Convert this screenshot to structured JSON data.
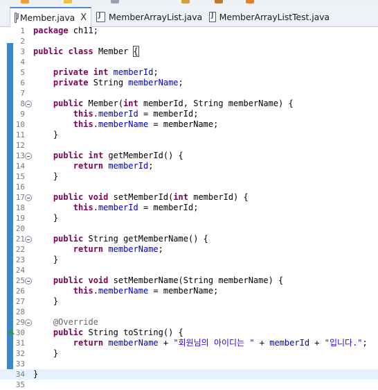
{
  "tabs": [
    {
      "label": "Member.java",
      "active": true,
      "close": "X"
    },
    {
      "label": "MemberArrayList.java",
      "active": false
    },
    {
      "label": "MemberArrayListTest.java",
      "active": false
    }
  ],
  "colors": {
    "keyword": "#7f0055",
    "field": "#0000c0",
    "string": "#2a00ff",
    "annotation": "#646464",
    "line_number": "#787878",
    "current_line": "#e8f2fe",
    "change_bar": "#3f86c8"
  },
  "editor": {
    "current_line": 34,
    "lines": [
      {
        "n": "1",
        "tokens": [
          [
            "kw",
            "package"
          ],
          [
            "t",
            " ch11;"
          ]
        ]
      },
      {
        "n": "2",
        "tokens": []
      },
      {
        "n": "3",
        "tokens": [
          [
            "kw",
            "public"
          ],
          [
            "t",
            " "
          ],
          [
            "kw",
            "class"
          ],
          [
            "t",
            " Member "
          ],
          [
            "brace",
            "{"
          ]
        ]
      },
      {
        "n": "4",
        "tokens": []
      },
      {
        "n": "5",
        "tokens": [
          [
            "t",
            "    "
          ],
          [
            "kw",
            "private"
          ],
          [
            "t",
            " "
          ],
          [
            "kw",
            "int"
          ],
          [
            "t",
            " "
          ],
          [
            "fld",
            "memberId"
          ],
          [
            "t",
            ";"
          ]
        ]
      },
      {
        "n": "6",
        "tokens": [
          [
            "t",
            "    "
          ],
          [
            "kw",
            "private"
          ],
          [
            "t",
            " String "
          ],
          [
            "fld",
            "memberName"
          ],
          [
            "t",
            ";"
          ]
        ]
      },
      {
        "n": "7",
        "tokens": []
      },
      {
        "n": "8",
        "fold": true,
        "tokens": [
          [
            "t",
            "    "
          ],
          [
            "kw",
            "public"
          ],
          [
            "t",
            " Member("
          ],
          [
            "kw",
            "int"
          ],
          [
            "t",
            " memberId, String memberName) {"
          ]
        ]
      },
      {
        "n": "9",
        "tokens": [
          [
            "t",
            "        "
          ],
          [
            "kw",
            "this"
          ],
          [
            "t",
            "."
          ],
          [
            "fld",
            "memberId"
          ],
          [
            "t",
            " = memberId;"
          ]
        ]
      },
      {
        "n": "10",
        "tokens": [
          [
            "t",
            "        "
          ],
          [
            "kw",
            "this"
          ],
          [
            "t",
            "."
          ],
          [
            "fld",
            "memberName"
          ],
          [
            "t",
            " = memberName;"
          ]
        ]
      },
      {
        "n": "11",
        "tokens": [
          [
            "t",
            "    }"
          ]
        ]
      },
      {
        "n": "12",
        "tokens": []
      },
      {
        "n": "13",
        "fold": true,
        "tokens": [
          [
            "t",
            "    "
          ],
          [
            "kw",
            "public"
          ],
          [
            "t",
            " "
          ],
          [
            "kw",
            "int"
          ],
          [
            "t",
            " getMemberId() {"
          ]
        ]
      },
      {
        "n": "14",
        "tokens": [
          [
            "t",
            "        "
          ],
          [
            "kw",
            "return"
          ],
          [
            "t",
            " "
          ],
          [
            "fld",
            "memberId"
          ],
          [
            "t",
            ";"
          ]
        ]
      },
      {
        "n": "15",
        "tokens": [
          [
            "t",
            "    }"
          ]
        ]
      },
      {
        "n": "16",
        "tokens": []
      },
      {
        "n": "17",
        "fold": true,
        "tokens": [
          [
            "t",
            "    "
          ],
          [
            "kw",
            "public"
          ],
          [
            "t",
            " "
          ],
          [
            "kw",
            "void"
          ],
          [
            "t",
            " setMemberId("
          ],
          [
            "kw",
            "int"
          ],
          [
            "t",
            " memberId) {"
          ]
        ]
      },
      {
        "n": "18",
        "tokens": [
          [
            "t",
            "        "
          ],
          [
            "kw",
            "this"
          ],
          [
            "t",
            "."
          ],
          [
            "fld",
            "memberId"
          ],
          [
            "t",
            " = memberId;"
          ]
        ]
      },
      {
        "n": "19",
        "tokens": [
          [
            "t",
            "    }"
          ]
        ]
      },
      {
        "n": "20",
        "tokens": []
      },
      {
        "n": "21",
        "fold": true,
        "tokens": [
          [
            "t",
            "    "
          ],
          [
            "kw",
            "public"
          ],
          [
            "t",
            " String getMemberName() {"
          ]
        ]
      },
      {
        "n": "22",
        "tokens": [
          [
            "t",
            "        "
          ],
          [
            "kw",
            "return"
          ],
          [
            "t",
            " "
          ],
          [
            "fld",
            "memberName"
          ],
          [
            "t",
            ";"
          ]
        ]
      },
      {
        "n": "23",
        "tokens": [
          [
            "t",
            "    }"
          ]
        ]
      },
      {
        "n": "24",
        "tokens": []
      },
      {
        "n": "25",
        "fold": true,
        "tokens": [
          [
            "t",
            "    "
          ],
          [
            "kw",
            "public"
          ],
          [
            "t",
            " "
          ],
          [
            "kw",
            "void"
          ],
          [
            "t",
            " setMemberName(String memberName) {"
          ]
        ]
      },
      {
        "n": "26",
        "tokens": [
          [
            "t",
            "        "
          ],
          [
            "kw",
            "this"
          ],
          [
            "t",
            "."
          ],
          [
            "fld",
            "memberName"
          ],
          [
            "t",
            " = memberName;"
          ]
        ]
      },
      {
        "n": "27",
        "tokens": [
          [
            "t",
            "    }"
          ]
        ]
      },
      {
        "n": "28",
        "tokens": []
      },
      {
        "n": "29",
        "fold": true,
        "tokens": [
          [
            "t",
            "    "
          ],
          [
            "ann",
            "@Override"
          ]
        ]
      },
      {
        "n": "30",
        "marker": true,
        "tokens": [
          [
            "t",
            "    "
          ],
          [
            "kw",
            "public"
          ],
          [
            "t",
            " String toString() {"
          ]
        ]
      },
      {
        "n": "31",
        "tokens": [
          [
            "t",
            "        "
          ],
          [
            "kw",
            "return"
          ],
          [
            "t",
            " "
          ],
          [
            "fld",
            "memberName"
          ],
          [
            "t",
            " + "
          ],
          [
            "str",
            "\"회원님의 아이디는 \""
          ],
          [
            "t",
            " + "
          ],
          [
            "fld",
            "memberId"
          ],
          [
            "t",
            " + "
          ],
          [
            "str",
            "\"입니다.\""
          ],
          [
            "t",
            ";"
          ]
        ]
      },
      {
        "n": "32",
        "tokens": [
          [
            "t",
            "    }"
          ]
        ]
      },
      {
        "n": "33",
        "tokens": []
      },
      {
        "n": "34",
        "tokens": [
          [
            "t",
            "}"
          ]
        ]
      },
      {
        "n": "35",
        "tokens": []
      }
    ]
  }
}
